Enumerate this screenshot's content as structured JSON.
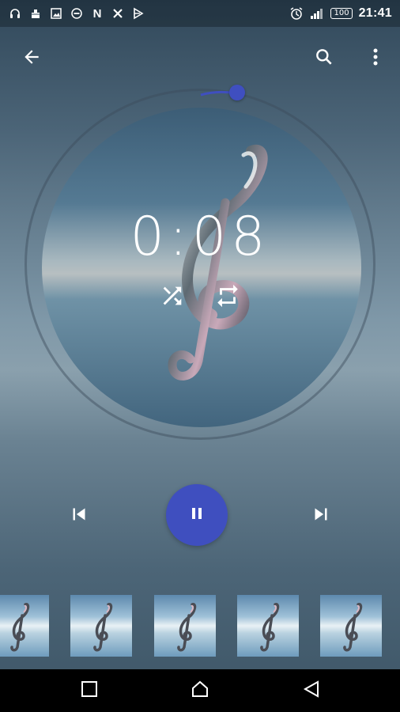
{
  "status_bar": {
    "left_icons": [
      "headphones-icon",
      "bug-icon",
      "image-icon",
      "do-not-disturb-icon",
      "n-icon",
      "x-icon",
      "store-icon"
    ],
    "n_glyph": "N",
    "battery_percent": "100",
    "time": "21:41",
    "right_icons": [
      "alarm-icon",
      "signal-icon",
      "battery-icon"
    ]
  },
  "player": {
    "elapsed": "0:08",
    "progress_fraction": 0.06,
    "state": "playing",
    "accent_color": "#3f4fbf"
  },
  "toolbar_icons": {
    "back": "arrow-left-icon",
    "search": "search-icon",
    "more": "more-vert-icon",
    "shuffle": "shuffle-icon",
    "repeat": "repeat-icon",
    "previous": "skip-previous-icon",
    "pause": "pause-icon",
    "next": "skip-next-icon"
  },
  "thumbnails": {
    "count_visible": 5,
    "image": "treble-clef-artwork"
  },
  "nav_bar": {
    "icons": [
      "recents-square-icon",
      "home-icon",
      "back-triangle-icon"
    ]
  }
}
